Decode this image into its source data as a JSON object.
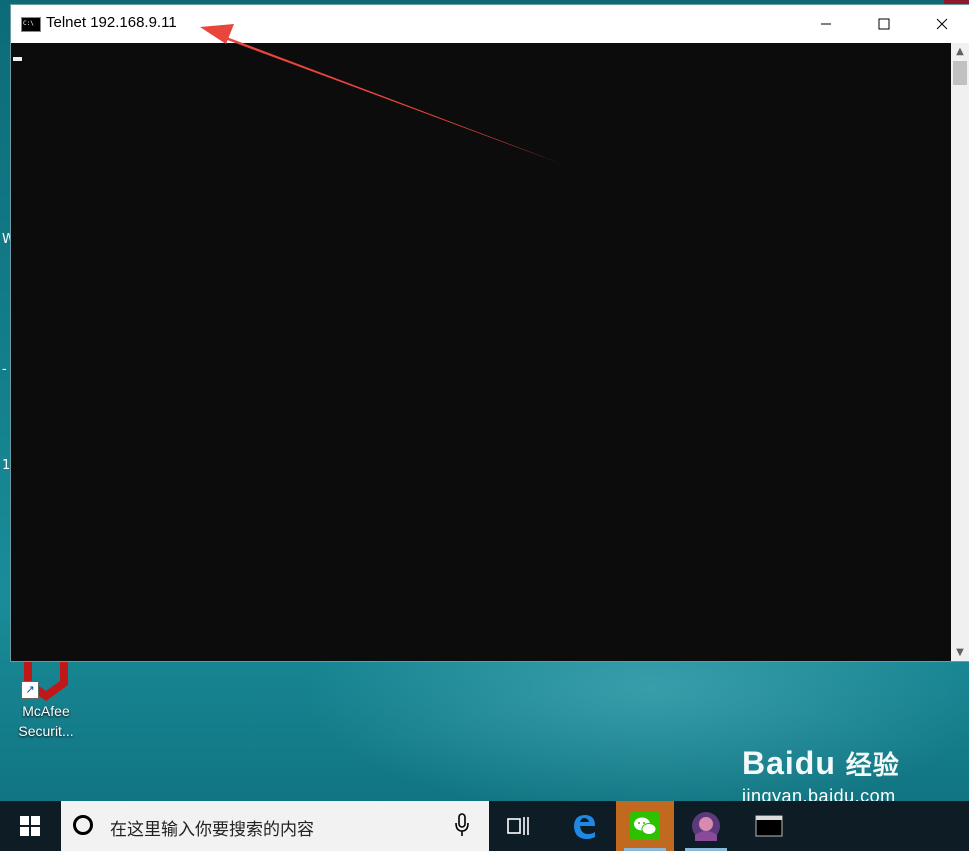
{
  "window": {
    "title": "Telnet 192.168.9.11",
    "console_icon_text": "C:\\",
    "minimize_symbol": "—",
    "close_symbol": "✕"
  },
  "desktop": {
    "icons": [
      {
        "label_line1": "McAfee",
        "label_line2": "Securit...",
        "icon": "mcafee-shield-icon"
      }
    ],
    "edge_marks": [
      "W",
      "-",
      "1"
    ]
  },
  "taskbar": {
    "search_placeholder": "在这里输入你要搜索的内容",
    "items": [
      "start-icon",
      "task-view-icon",
      "edge-icon",
      "wechat-icon",
      "game-avatar-icon",
      "cmd-icon"
    ]
  },
  "watermark": {
    "brand": "Baidu",
    "brand_cn": "经验",
    "url": "jingyan.baidu.com"
  },
  "colors": {
    "arrow": "#e8453c",
    "wechat_active": "#c16a1f",
    "console_bg": "#0c0c0c"
  }
}
